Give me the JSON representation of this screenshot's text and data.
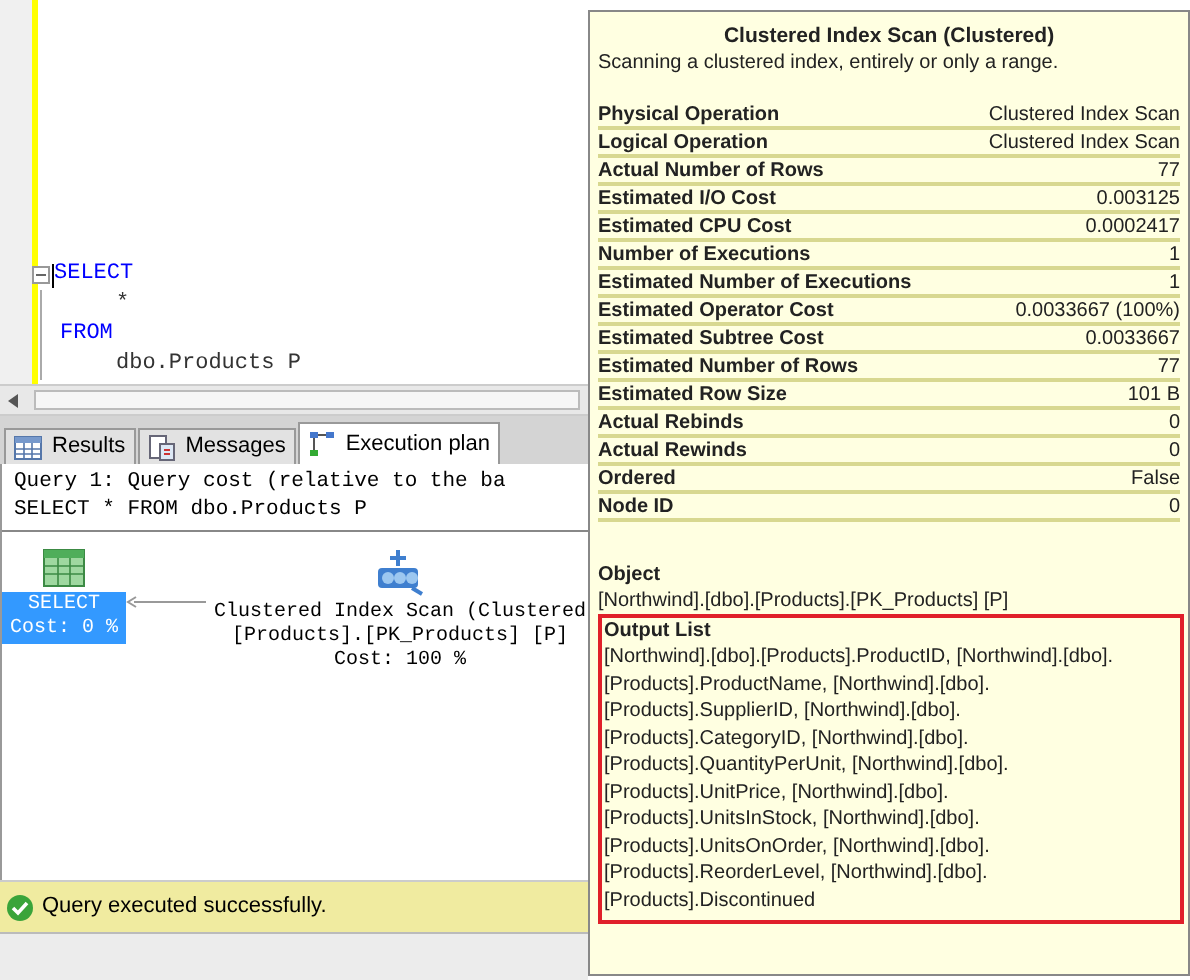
{
  "editor": {
    "lines": [
      {
        "text": "SELECT",
        "kind": "keyword"
      },
      {
        "text": "*",
        "kind": "plain"
      },
      {
        "text": "FROM",
        "kind": "keyword"
      },
      {
        "text": "dbo.Products P",
        "kind": "plain"
      }
    ]
  },
  "tabs": [
    {
      "label": "Results",
      "selected": false,
      "kind": "grid"
    },
    {
      "label": "Messages",
      "selected": false,
      "kind": "messages"
    },
    {
      "label": "Execution plan",
      "selected": true,
      "kind": "plan"
    }
  ],
  "plan": {
    "header": [
      "Query 1: Query cost (relative to the ba",
      "SELECT * FROM dbo.Products P"
    ],
    "nodes": [
      {
        "kind": "select",
        "lines": [
          "SELECT",
          "Cost: 0 %"
        ],
        "selected": true
      },
      {
        "kind": "scan",
        "lines": [
          "Clustered Index Scan (Clustered",
          "[Products].[PK_Products] [P]",
          "Cost: 100 %"
        ],
        "selected": false
      }
    ]
  },
  "status": "Query executed successfully.",
  "tooltip": {
    "title": "Clustered Index Scan (Clustered)",
    "description": "Scanning a clustered index, entirely or only a range.",
    "properties": [
      {
        "label": "Physical Operation",
        "value": "Clustered Index Scan"
      },
      {
        "label": "Logical Operation",
        "value": "Clustered Index Scan"
      },
      {
        "label": "Actual Number of Rows",
        "value": "77"
      },
      {
        "label": "Estimated I/O Cost",
        "value": "0.003125"
      },
      {
        "label": "Estimated CPU Cost",
        "value": "0.0002417"
      },
      {
        "label": "Number of Executions",
        "value": "1"
      },
      {
        "label": "Estimated Number of Executions",
        "value": "1"
      },
      {
        "label": "Estimated Operator Cost",
        "value": "0.0033667 (100%)"
      },
      {
        "label": "Estimated Subtree Cost",
        "value": "0.0033667"
      },
      {
        "label": "Estimated Number of Rows",
        "value": "77"
      },
      {
        "label": "Estimated Row Size",
        "value": "101 B"
      },
      {
        "label": "Actual Rebinds",
        "value": "0"
      },
      {
        "label": "Actual Rewinds",
        "value": "0"
      },
      {
        "label": "Ordered",
        "value": "False"
      },
      {
        "label": "Node ID",
        "value": "0"
      }
    ],
    "object": {
      "heading": "Object",
      "value": "[Northwind].[dbo].[Products].[PK_Products] [P]"
    },
    "output_list": {
      "heading": "Output List",
      "lines": [
        "[Northwind].[dbo].[Products].ProductID, [Northwind].[dbo].",
        "[Products].ProductName, [Northwind].[dbo].",
        "[Products].SupplierID, [Northwind].[dbo].",
        "[Products].CategoryID, [Northwind].[dbo].",
        "[Products].QuantityPerUnit, [Northwind].[dbo].",
        "[Products].UnitPrice, [Northwind].[dbo].",
        "[Products].UnitsInStock, [Northwind].[dbo].",
        "[Products].UnitsOnOrder, [Northwind].[dbo].",
        "[Products].ReorderLevel, [Northwind].[dbo].",
        "[Products].Discontinued"
      ]
    }
  }
}
